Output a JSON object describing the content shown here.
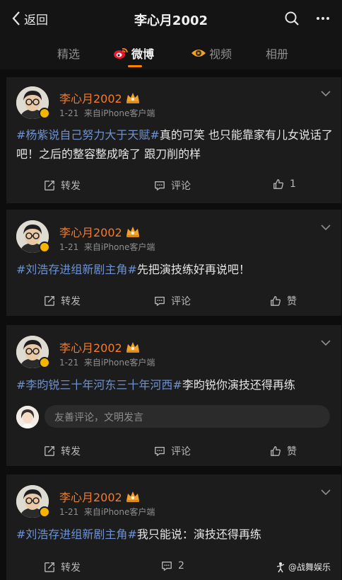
{
  "nav": {
    "back_label": "返回",
    "title": "李心月2002"
  },
  "tabs": [
    {
      "label": "精选",
      "active": false
    },
    {
      "label": "微博",
      "active": true
    },
    {
      "label": "视频",
      "active": false
    },
    {
      "label": "相册",
      "active": false
    }
  ],
  "colors": {
    "accent": "#ff8200",
    "username": "#f27b2c",
    "topic": "#6e92cf",
    "background": "#0d0d0d",
    "card": "#1c1c1c"
  },
  "posts": [
    {
      "username": "李心月2002",
      "date": "1-21",
      "source": "来自iPhone客户端",
      "topic": "#杨紫说自己努力大于天赋#",
      "text": "真的可笑 也只能靠家有儿女说话了吧！之后的整容整成啥了 跟刀削的样",
      "repost_label": "转发",
      "comment_label": "评论",
      "like_label": "1"
    },
    {
      "username": "李心月2002",
      "date": "1-21",
      "source": "来自iPhone客户端",
      "topic": "#刘浩存进组新剧主角#",
      "text": "先把演技练好再说吧！",
      "repost_label": "转发",
      "comment_label": "评论",
      "like_label": "赞"
    },
    {
      "username": "李心月2002",
      "date": "1-21",
      "source": "来自iPhone客户端",
      "topic": "#李昀锐三十年河东三十年河西#",
      "text": "李昀锐你演技还得再练",
      "comment_placeholder": "友善评论，文明发言",
      "repost_label": "转发",
      "comment_label": "评论",
      "like_label": "赞"
    },
    {
      "username": "李心月2002",
      "date": "1-21",
      "source": "来自iPhone客户端",
      "topic": "#刘浩存进组新剧主角#",
      "text": "我只能说：演技还得再练",
      "repost_label": "转发",
      "comment_label": "2"
    }
  ],
  "watermark": "@战舞娱乐"
}
